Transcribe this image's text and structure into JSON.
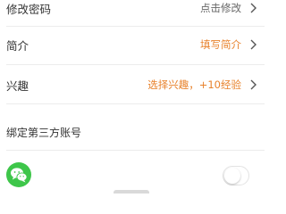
{
  "rows": [
    {
      "label": "修改密码",
      "value": "点击修改"
    },
    {
      "label": "简介",
      "value": "填写简介"
    },
    {
      "label": "兴趣",
      "value": "选择兴趣，+10经验"
    }
  ],
  "bind_section": {
    "title": "绑定第三方账号"
  },
  "colors": {
    "accent": "#e8822c",
    "value_gray": "#666666",
    "wechat_green": "#3ec64a"
  },
  "icons": {
    "chevron": "chevron-right-icon",
    "wechat": "wechat-icon"
  },
  "wechat_toggle": {
    "on": false
  }
}
